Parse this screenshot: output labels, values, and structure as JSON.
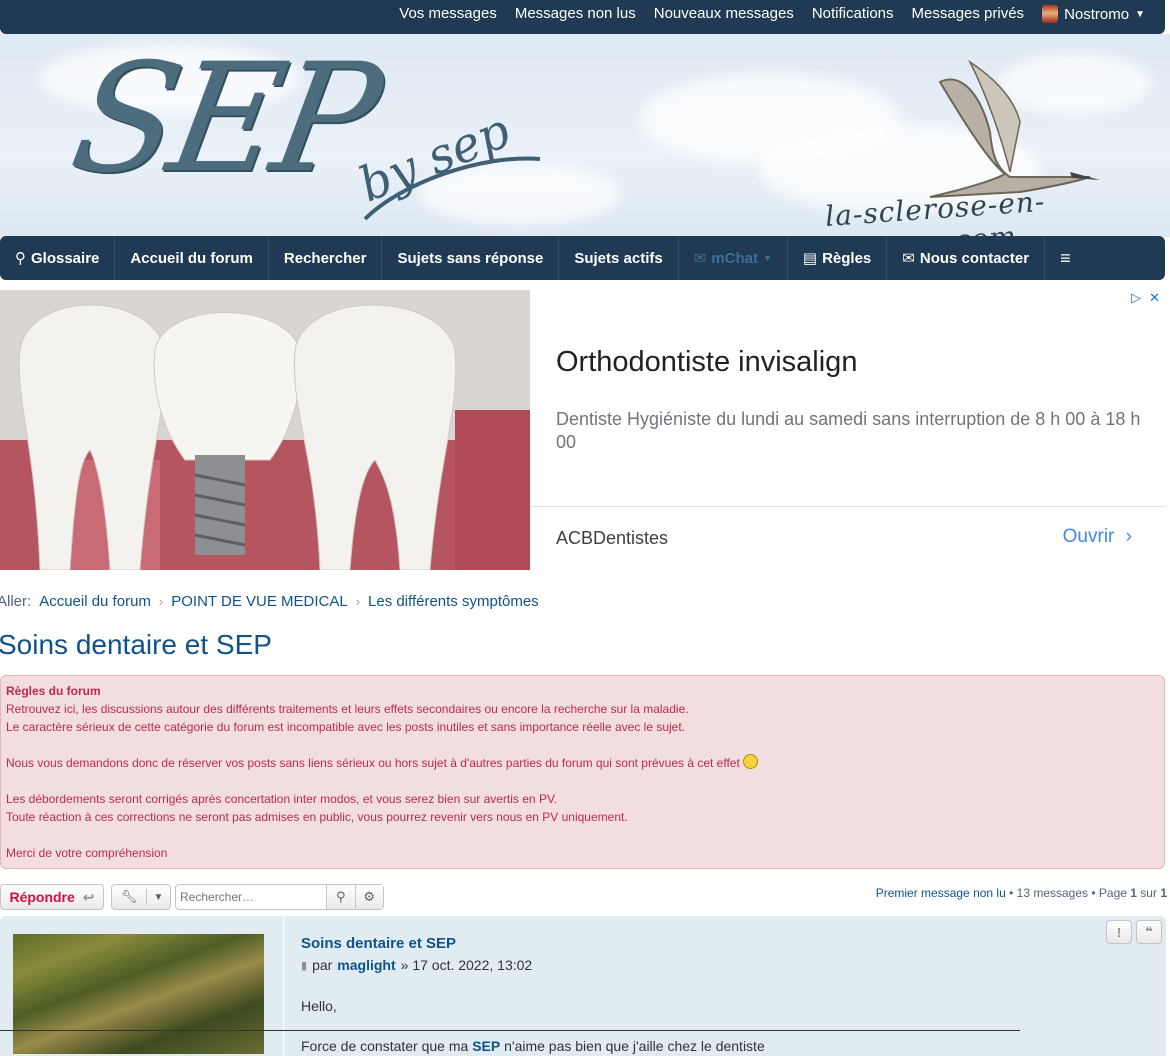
{
  "topbar": {
    "links": [
      "Vos messages",
      "Messages non lus",
      "Nouveaux messages",
      "Notifications",
      "Messages privés"
    ],
    "username": "Nostromo"
  },
  "banner": {
    "logo_main": "SEP",
    "logo_by": "by sep",
    "logo_sub": "la-sclerose-en-plaques.com"
  },
  "nav": {
    "glossaire": "Glossaire",
    "accueil": "Accueil du forum",
    "rechercher": "Rechercher",
    "sans_reponse": "Sujets sans réponse",
    "actifs": "Sujets actifs",
    "mchat": "mChat",
    "regles": "Règles",
    "contact": "Nous contacter"
  },
  "ad": {
    "title": "Orthodontiste invisalign",
    "description": "Dentiste Hygiéniste du lundi au samedi sans interruption de 8 h 00 à 18 h 00",
    "advertiser": "ACBDentistes",
    "cta": "Ouvrir"
  },
  "breadcrumb": {
    "prefix": "Aller:",
    "items": [
      "Accueil du forum",
      "POINT DE VUE MEDICAL",
      "Les différents symptômes"
    ]
  },
  "topic_title": "Soins dentaire et SEP",
  "rules": {
    "heading": "Règles du forum",
    "line1": "Retrouvez ici, les discussions autour des différents traitements et leurs effets secondaires ou encore la recherche sur la maladie.",
    "line2": "Le caractère sérieux de cette catégorie du forum est incompatible avec les posts inutiles et sans importance réelle avec le sujet.",
    "line3": "Nous vous demandons donc de réserver vos posts sans liens sérieux ou hors sujet à d'autres parties du forum qui sont prévues à cet effet",
    "line4": "Les débordements seront corrigés après concertation inter modos, et vous serez bien sur avertis en PV.",
    "line5": "Toute réaction à ces corrections ne seront pas admises en public, vous pourrez revenir vers nous en PV uniquement.",
    "line6": "Merci de votre compréhension"
  },
  "actions": {
    "reply_label": "Répondre",
    "search_placeholder": "Rechercher…"
  },
  "pagination": {
    "first_unread": "Premier message non lu",
    "summary": "• 13 messages • Page",
    "page": "1",
    "of": "sur",
    "total": "1"
  },
  "post": {
    "title": "Soins dentaire et SEP",
    "by": "par",
    "author": "maglight",
    "date": "» 17 oct. 2022, 13:02",
    "greeting": "Hello,",
    "text_start": "Force de constater que ma",
    "text_bold": "SEP",
    "text_end": "n'aime pas bien que j'aille chez le dentiste"
  }
}
